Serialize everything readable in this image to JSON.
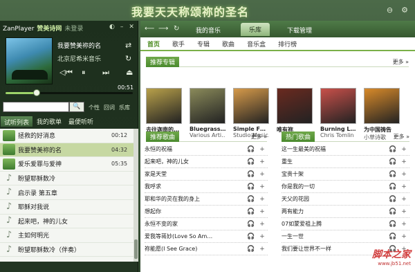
{
  "banner": "我要天天称颂祢的圣名",
  "app": {
    "name": "ZanPlayer",
    "subtitle": "赞美诗网",
    "login": "未登录"
  },
  "now_playing": {
    "title": "我要赞美祢的名",
    "artist": "北京尼希米音乐",
    "time": "00:51",
    "progress": 0.24
  },
  "search": {
    "placeholder": "",
    "links": [
      "个性",
      "回词",
      "乐库"
    ]
  },
  "left_tabs": [
    "试听列表",
    "我的歌单",
    "最便听听"
  ],
  "playlist": [
    {
      "title": "拯救的好消息",
      "time": "00:12",
      "icon": "cover"
    },
    {
      "title": "我要赞美祢的名",
      "time": "04:32",
      "icon": "cover",
      "active": true
    },
    {
      "title": "爱乐爱罪与爱神",
      "time": "05:35",
      "icon": "cover"
    },
    {
      "title": "盼望耶稣数冷",
      "time": "",
      "icon": "note"
    },
    {
      "title": "启示录 第五章",
      "time": "",
      "icon": "note"
    },
    {
      "title": "耶稣对我说",
      "time": "",
      "icon": "note"
    },
    {
      "title": "起来吧，神的儿女",
      "time": "",
      "icon": "note"
    },
    {
      "title": "主如何明光",
      "time": "",
      "icon": "note"
    },
    {
      "title": "盼望耶稣数冷（伴奏）",
      "time": "",
      "icon": "note"
    }
  ],
  "nav": {
    "tabs": [
      "我的音乐",
      "乐库",
      "下载管理"
    ],
    "active": "乐库"
  },
  "subtabs": [
    "首页",
    "歌手",
    "专辑",
    "歌曲",
    "音乐盒",
    "排行榜"
  ],
  "albums_section": {
    "title": "推荐专辑",
    "more": "更多 »"
  },
  "albums": [
    {
      "title": "去往迦南的…",
      "artist": "迦赞美诗作歌",
      "color": "#b8a04a"
    },
    {
      "title": "Bluegrass…",
      "artist": "Various Arti…",
      "color": "#8a8a5a"
    },
    {
      "title": "Simple F…",
      "artist": "Studio Music…",
      "color": "#d69a4a"
    },
    {
      "title": "唯有祢",
      "artist": "",
      "color": "#6a2a20"
    },
    {
      "title": "Burning L…",
      "artist": "Chris Tomlin",
      "color": "#c8504a"
    },
    {
      "title": "为中国祷告",
      "artist": "小草诗歌",
      "color": "#d88a2a"
    }
  ],
  "rec_songs": {
    "title": "推荐歌曲",
    "more": "更多 »",
    "items": [
      "永恒的祝福",
      "起来吧，神的儿女",
      "家是天堂",
      "我呼求",
      "耶和华的灵在我的身上",
      "想起你",
      "永恒不变的家",
      "爱我等蒋妙(Love So Am…",
      "祢能愿(I See Grace)"
    ]
  },
  "hot_songs": {
    "title": "热门歌曲",
    "more": "更多 »",
    "items": [
      "这一生最美的祝福",
      "重生",
      "宝贵十架",
      "你是我的一切",
      "天父的花园",
      "两有能力",
      "07如蒙爱祖上腾",
      "一生一世",
      "我们要让世界不一样"
    ]
  },
  "watermark": {
    "text": "脚本之家",
    "url": "www.jb51.net"
  }
}
